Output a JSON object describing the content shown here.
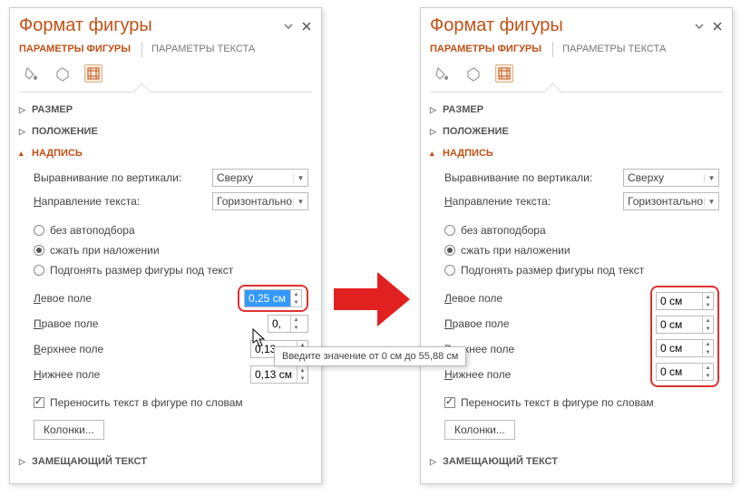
{
  "title": "Формат фигуры",
  "tabs": {
    "shape": "ПАРАМЕТРЫ ФИГУРЫ",
    "text": "ПАРАМЕТРЫ ТЕКСТА"
  },
  "sections": {
    "size": "РАЗМЕР",
    "position": "ПОЛОЖЕНИЕ",
    "textbox": "НАДПИСЬ",
    "alttext": "ЗАМЕЩАЮЩИЙ ТЕКСТ"
  },
  "textbox": {
    "valign_label": "Выравнивание по вертикали:",
    "valign_value": "Сверху",
    "direction_label": "Направление текста:",
    "direction_value": "Горизонтально",
    "radio_nofit": "без автоподбора",
    "radio_shrink": "сжать при наложении",
    "radio_resize": "Подгонять размер фигуры под текст",
    "margin_left": "Левое поле",
    "margin_right": "Правое поле",
    "margin_top": "Верхнее поле",
    "margin_bottom": "Нижнее поле",
    "wrap_label": "Переносить текст в фигуре по словам",
    "columns_btn": "Колонки..."
  },
  "values_left": {
    "ml": "0,25 см",
    "mr": "0,",
    "mt": "0,13 см",
    "mb": "0,13 см"
  },
  "values_right": {
    "ml": "0 см",
    "mr": "0 см",
    "mt": "0 см",
    "mb": "0 см"
  },
  "tooltip": "Введите значение от 0 см до 55,88 см"
}
